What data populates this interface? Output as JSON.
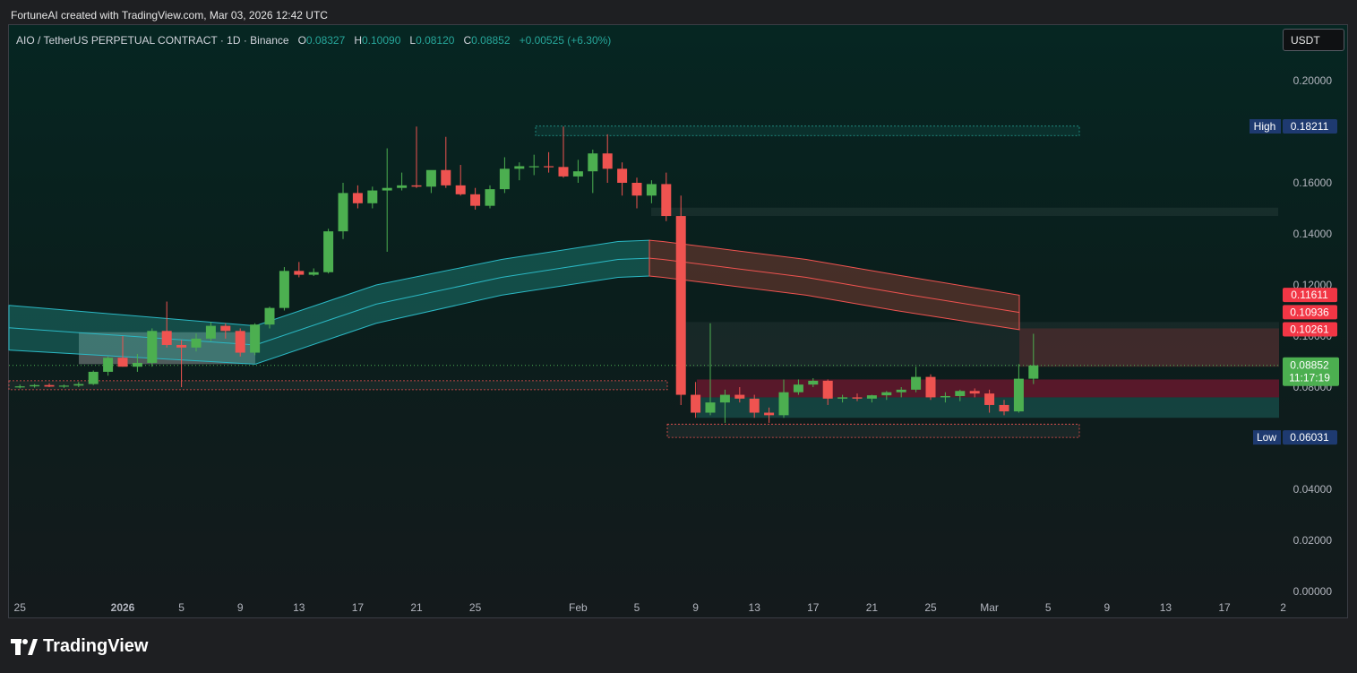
{
  "caption": "FortuneAI created with TradingView.com, Mar 03, 2026 12:42 UTC",
  "legend": {
    "symbol": "AIO / TetherUS PERPETUAL CONTRACT · 1D · Binance",
    "o_label": "O",
    "o": "0.08327",
    "h_label": "H",
    "h": "0.10090",
    "l_label": "L",
    "l": "0.08120",
    "c_label": "C",
    "c": "0.08852",
    "change": "+0.00525 (+6.30%)"
  },
  "currency_button": "USDT",
  "brand": "TradingView",
  "colors": {
    "up": "#4caf50",
    "down": "#ef5350",
    "teal": "#26a69a",
    "high_badge": "#1e3a70",
    "price_badge": "#4caf50",
    "red_badge": "#f23645"
  },
  "chart_data": {
    "type": "candlestick",
    "ylim": [
      0,
      0.21
    ],
    "y_ticks": [
      "0.20000",
      "0.16000",
      "0.14000",
      "0.12000",
      "0.10000",
      "0.08000",
      "0.04000",
      "0.02000",
      "0.00000"
    ],
    "y_tick_values": [
      0.2,
      0.16,
      0.14,
      0.12,
      0.1,
      0.08,
      0.04,
      0.02,
      0.0
    ],
    "x_ticks": [
      "25",
      "2026",
      "5",
      "9",
      "13",
      "17",
      "21",
      "25",
      "Feb",
      "5",
      "9",
      "13",
      "17",
      "21",
      "25",
      "Mar",
      "5",
      "9",
      "13",
      "17",
      "2"
    ],
    "x_tick_days": [
      -7,
      0,
      4,
      8,
      12,
      16,
      20,
      24,
      31,
      35,
      39,
      43,
      47,
      51,
      55,
      59,
      63,
      67,
      71,
      75,
      79
    ],
    "first_candle_day": -7,
    "candles": [
      [
        0.08,
        0.081,
        0.0795,
        0.0803
      ],
      [
        0.0803,
        0.0812,
        0.0798,
        0.0808
      ],
      [
        0.0808,
        0.0815,
        0.08,
        0.0802
      ],
      [
        0.0802,
        0.081,
        0.0797,
        0.0806
      ],
      [
        0.0806,
        0.082,
        0.08,
        0.0812
      ],
      [
        0.0812,
        0.0865,
        0.0808,
        0.086
      ],
      [
        0.086,
        0.092,
        0.0845,
        0.0915
      ],
      [
        0.0915,
        0.1,
        0.088,
        0.088
      ],
      [
        0.088,
        0.093,
        0.086,
        0.0895
      ],
      [
        0.0895,
        0.103,
        0.088,
        0.102
      ],
      [
        0.102,
        0.1135,
        0.0955,
        0.0965
      ],
      [
        0.0965,
        0.0985,
        0.08,
        0.0955
      ],
      [
        0.0955,
        0.101,
        0.094,
        0.099
      ],
      [
        0.099,
        0.1055,
        0.098,
        0.104
      ],
      [
        0.104,
        0.105,
        0.099,
        0.102
      ],
      [
        0.102,
        0.103,
        0.092,
        0.0935
      ],
      [
        0.0935,
        0.105,
        0.0925,
        0.1045
      ],
      [
        0.1045,
        0.1115,
        0.103,
        0.111
      ],
      [
        0.111,
        0.127,
        0.11,
        0.1255
      ],
      [
        0.1255,
        0.129,
        0.123,
        0.124
      ],
      [
        0.124,
        0.1265,
        0.1235,
        0.125
      ],
      [
        0.125,
        0.142,
        0.1245,
        0.141
      ],
      [
        0.141,
        0.16,
        0.138,
        0.156
      ],
      [
        0.156,
        0.159,
        0.15,
        0.152
      ],
      [
        0.152,
        0.1585,
        0.15,
        0.157
      ],
      [
        0.157,
        0.1735,
        0.133,
        0.158
      ],
      [
        0.158,
        0.164,
        0.157,
        0.159
      ],
      [
        0.159,
        0.182,
        0.158,
        0.1585
      ],
      [
        0.1585,
        0.164,
        0.156,
        0.165
      ],
      [
        0.165,
        0.178,
        0.158,
        0.159
      ],
      [
        0.159,
        0.167,
        0.155,
        0.1555
      ],
      [
        0.1555,
        0.158,
        0.1495,
        0.151
      ],
      [
        0.151,
        0.159,
        0.15,
        0.1575
      ],
      [
        0.1575,
        0.17,
        0.156,
        0.1655
      ],
      [
        0.1655,
        0.168,
        0.161,
        0.1665
      ],
      [
        0.1665,
        0.171,
        0.163,
        0.1665
      ],
      [
        0.1665,
        0.172,
        0.164,
        0.1662
      ],
      [
        0.1662,
        0.182,
        0.162,
        0.1625
      ],
      [
        0.1625,
        0.169,
        0.16,
        0.1645
      ],
      [
        0.1645,
        0.173,
        0.156,
        0.1715
      ],
      [
        0.1715,
        0.179,
        0.16,
        0.1655
      ],
      [
        0.1655,
        0.168,
        0.155,
        0.16
      ],
      [
        0.16,
        0.162,
        0.15,
        0.155
      ],
      [
        0.155,
        0.161,
        0.152,
        0.1595
      ],
      [
        0.1595,
        0.164,
        0.145,
        0.147
      ],
      [
        0.147,
        0.155,
        0.073,
        0.077
      ],
      [
        0.077,
        0.082,
        0.068,
        0.07
      ],
      [
        0.07,
        0.105,
        0.069,
        0.074
      ],
      [
        0.074,
        0.079,
        0.066,
        0.077
      ],
      [
        0.077,
        0.08,
        0.074,
        0.0755
      ],
      [
        0.0755,
        0.077,
        0.068,
        0.07
      ],
      [
        0.07,
        0.072,
        0.066,
        0.069
      ],
      [
        0.069,
        0.083,
        0.068,
        0.078
      ],
      [
        0.078,
        0.083,
        0.077,
        0.081
      ],
      [
        0.081,
        0.0835,
        0.08,
        0.0825
      ],
      [
        0.0825,
        0.083,
        0.073,
        0.0755
      ],
      [
        0.0755,
        0.077,
        0.074,
        0.076
      ],
      [
        0.076,
        0.0775,
        0.0745,
        0.0755
      ],
      [
        0.0755,
        0.077,
        0.074,
        0.0768
      ],
      [
        0.0768,
        0.0785,
        0.075,
        0.078
      ],
      [
        0.078,
        0.08,
        0.076,
        0.079
      ],
      [
        0.079,
        0.088,
        0.078,
        0.084
      ],
      [
        0.084,
        0.085,
        0.075,
        0.076
      ],
      [
        0.076,
        0.078,
        0.074,
        0.0765
      ],
      [
        0.0765,
        0.079,
        0.0745,
        0.0785
      ],
      [
        0.0785,
        0.0795,
        0.076,
        0.0775
      ],
      [
        0.0775,
        0.079,
        0.07,
        0.073
      ],
      [
        0.073,
        0.075,
        0.069,
        0.0705
      ],
      [
        0.0705,
        0.089,
        0.07,
        0.0833
      ],
      [
        0.0833,
        0.1009,
        0.0812,
        0.0885
      ]
    ],
    "price_lines": {
      "high": {
        "label": "High",
        "value": 0.18211,
        "text": "0.18211"
      },
      "low": {
        "label": "Low",
        "value": 0.06031,
        "text": "0.06031"
      },
      "last": {
        "value": 0.08852,
        "text": "0.08852",
        "countdown": "11:17:19"
      },
      "red_levels": [
        {
          "value": 0.11611,
          "text": "0.11611"
        },
        {
          "value": 0.10936,
          "text": "0.10936"
        },
        {
          "value": 0.10261,
          "text": "0.10261"
        }
      ]
    }
  }
}
